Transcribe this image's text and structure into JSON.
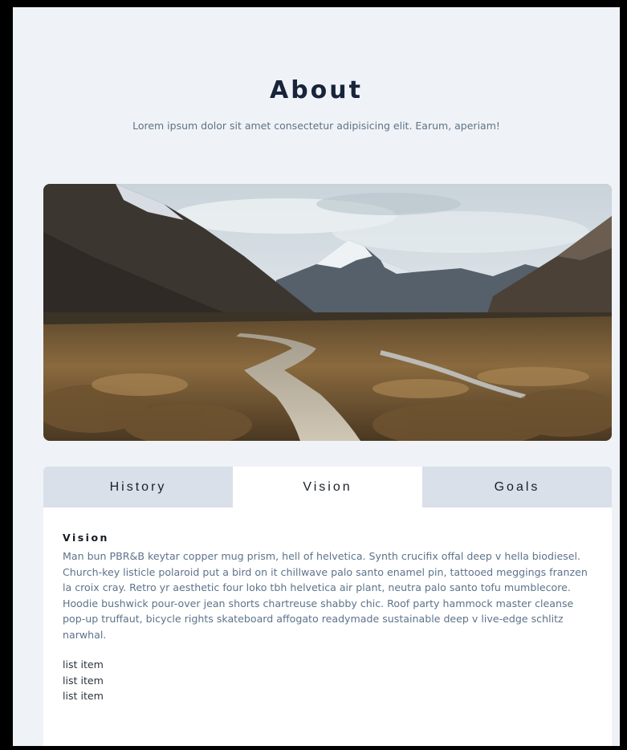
{
  "about": {
    "title": "About",
    "subtitle": "Lorem ipsum dolor sit amet consectetur adipisicing elit. Earum, aperiam!"
  },
  "hero": {
    "image_subject": "mountain valley with wooden boardwalk trail"
  },
  "tabs": [
    {
      "label": "History",
      "active": false
    },
    {
      "label": "Vision",
      "active": true
    },
    {
      "label": "Goals",
      "active": false
    }
  ],
  "panel": {
    "heading": "Vision",
    "text": "Man bun PBR&B keytar copper mug prism, hell of helvetica. Synth crucifix offal deep v hella biodiesel. Church-key listicle polaroid put a bird on it chillwave palo santo enamel pin, tattooed meggings franzen la croix cray. Retro yr aesthetic four loko tbh helvetica air plant, neutra palo santo tofu mumblecore. Hoodie bushwick pour-over jean shorts chartreuse shabby chic. Roof party hammock master cleanse pop-up truffaut, bicycle rights skateboard affogato readymade sustainable deep v live-edge schlitz narwhal.",
    "list": [
      "list item",
      "list item",
      "list item"
    ]
  },
  "colors": {
    "page_background": "#eff3f7",
    "title": "#17243a",
    "subtitle": "#5f7286",
    "tab_inactive": "#d9e0e9",
    "tab_active": "#ffffff",
    "body_text": "#5d738a"
  }
}
